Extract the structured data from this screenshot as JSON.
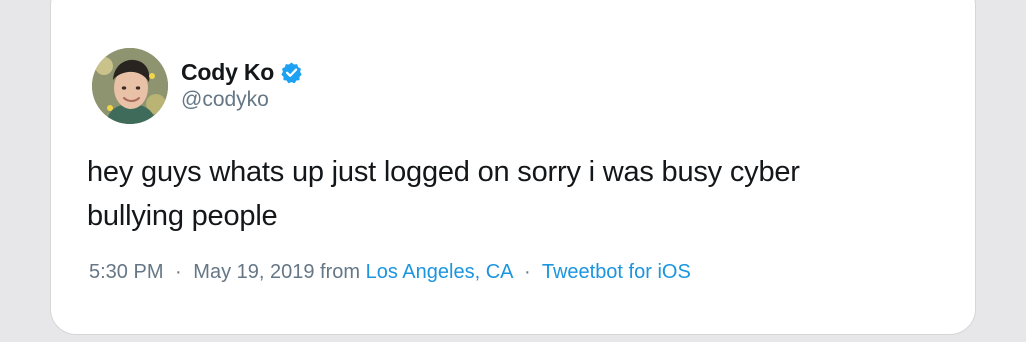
{
  "tweet": {
    "author": {
      "name": "Cody Ko",
      "handle": "@codyko",
      "verified": true,
      "avatar_icon": "user-avatar"
    },
    "text_line1": "hey guys whats up just logged on sorry i was busy cyber",
    "text_line2": "bullying people",
    "meta": {
      "time": "5:30 PM",
      "separator": "·",
      "date": "May 19, 2019",
      "from_label": "from",
      "location": "Los Angeles, CA",
      "client": "Tweetbot for iOS"
    }
  },
  "colors": {
    "text": "#14171a",
    "secondary": "#657786",
    "link": "#1b95e0",
    "verified": "#1da1f2",
    "background": "#e7e7e9",
    "card": "#ffffff"
  }
}
